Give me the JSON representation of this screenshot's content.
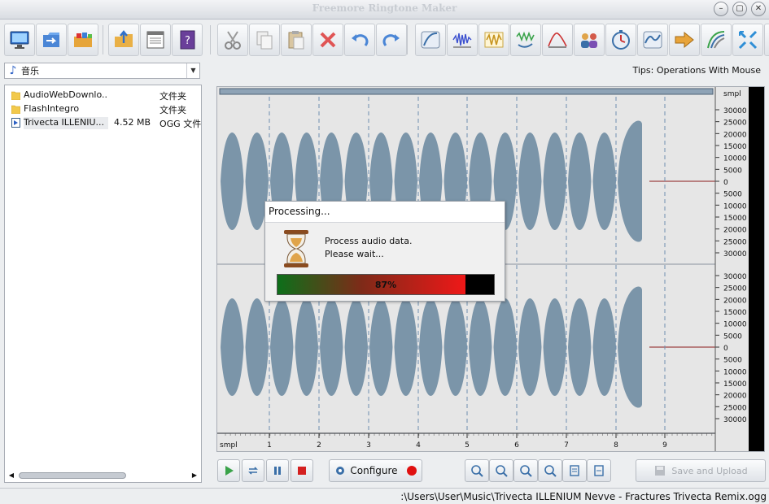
{
  "window": {
    "title": "Freemore Ringtone Maker",
    "controls": {
      "minimize": "–",
      "restore": "▢",
      "close": "✕"
    }
  },
  "toolbar": {
    "groups": [
      [
        "monitor-icon",
        "open-file-icon",
        "batch-files-icon"
      ],
      [
        "export-folder-icon",
        "list-window-icon",
        "help-book-icon"
      ],
      [
        "cut-icon",
        "copy-icon",
        "paste-icon",
        "delete-icon",
        "undo-icon",
        "redo-icon"
      ],
      [
        "fade-icon",
        "noise-icon",
        "amplify-icon",
        "echo-icon",
        "envelope-icon",
        "voices-icon",
        "timer-icon",
        "frequency-icon",
        "speed-icon",
        "curve-icon",
        "stretch-icon",
        "equalizer-icon"
      ]
    ]
  },
  "folder": {
    "selected": "音乐"
  },
  "tips": {
    "text": "Tips: Operations With Mouse"
  },
  "files": [
    {
      "name": "AudioWebDownlo...",
      "size": "",
      "type": "文件夹",
      "icon": "folder-icon",
      "selected": false
    },
    {
      "name": "FlashIntegro",
      "size": "",
      "type": "文件夹",
      "icon": "folder-icon",
      "selected": false
    },
    {
      "name": "Trivecta ILLENIU...",
      "size": "4.52 MB",
      "type": "OGG 文件",
      "icon": "audio-file-icon",
      "selected": true
    }
  ],
  "waveform": {
    "unit_label": "smpl",
    "x_ticks": [
      "1",
      "2",
      "3",
      "4",
      "5",
      "6",
      "7",
      "8",
      "9"
    ],
    "channel_ticks": [
      "30000",
      "25000",
      "20000",
      "15000",
      "10000",
      "5000",
      "0",
      "5000",
      "10000",
      "15000",
      "20000",
      "25000",
      "30000"
    ]
  },
  "dialog": {
    "title": "Processing...",
    "message_line1": "Process audio data.",
    "message_line2": "Please wait...",
    "progress_percent": 87,
    "progress_label": "87%"
  },
  "playback": {
    "configure_label": "Configure",
    "save_upload_label": "Save and Upload"
  },
  "status": {
    "path": ":\\Users\\User\\Music\\Trivecta ILLENIUM Nevve - Fractures Trivecta Remix.ogg"
  },
  "colors": {
    "wave": "#7b95a9",
    "accent": "#2b5fc4",
    "record": "#e01010"
  }
}
